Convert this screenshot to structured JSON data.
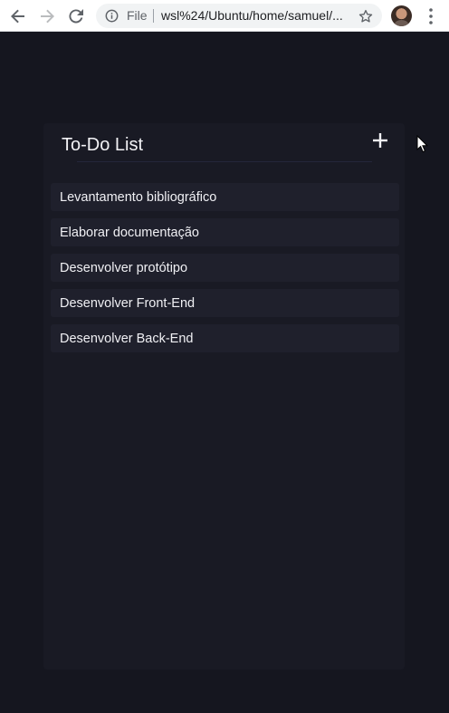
{
  "browser": {
    "scheme_label": "File",
    "url": "wsl%24/Ubuntu/home/samuel/...",
    "icons": {
      "back": "arrow-left-icon",
      "forward": "arrow-right-icon",
      "reload": "reload-icon",
      "info": "info-icon",
      "bookmark": "star-icon",
      "menu": "kebab-menu-icon"
    }
  },
  "app": {
    "title": "To-Do List",
    "add_icon": "plus-icon",
    "tasks": [
      {
        "label": "Levantamento bibliográfico"
      },
      {
        "label": "Elaborar documentação"
      },
      {
        "label": "Desenvolver protótipo"
      },
      {
        "label": "Desenvolver Front-End"
      },
      {
        "label": "Desenvolver Back-End"
      }
    ]
  },
  "colors": {
    "page_background": "#15161f",
    "panel_background": "#191a24",
    "task_background": "#1f202c",
    "text": "#f0f0f4"
  }
}
